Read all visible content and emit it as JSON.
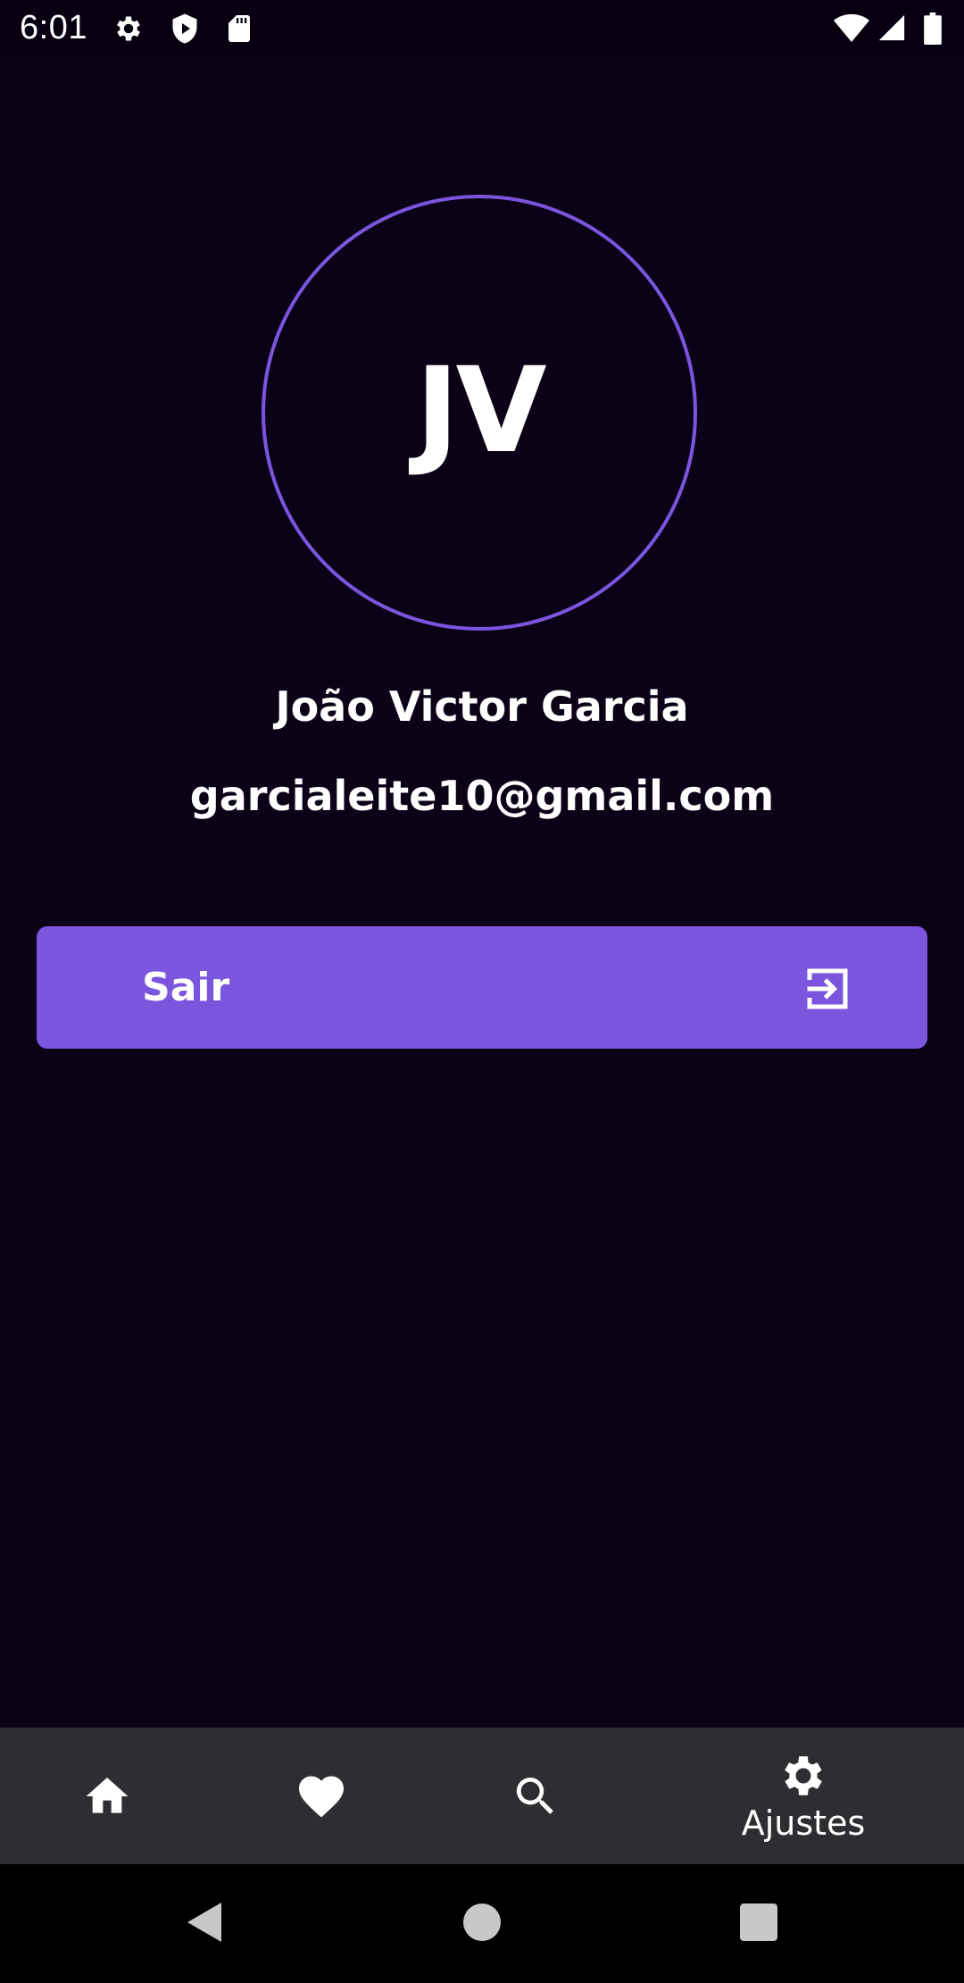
{
  "status_bar": {
    "time": "6:01",
    "left_icons": [
      "settings-icon",
      "shield-play-icon",
      "sd-card-icon"
    ],
    "right_icons": [
      "wifi-icon",
      "signal-icon",
      "battery-icon"
    ]
  },
  "profile": {
    "initials": "JV",
    "name": "João Victor Garcia",
    "email": "garcialeite10@gmail.com",
    "accent_color": "#7c55df"
  },
  "logout": {
    "label": "Sair",
    "icon": "logout-icon"
  },
  "bottom_nav": {
    "items": [
      {
        "icon": "home-icon",
        "label": ""
      },
      {
        "icon": "heart-icon",
        "label": ""
      },
      {
        "icon": "search-icon",
        "label": ""
      },
      {
        "icon": "gear-icon",
        "label": "Ajustes",
        "active": true
      }
    ]
  },
  "system_nav": {
    "buttons": [
      "back-icon",
      "home-circle-icon",
      "recents-icon"
    ]
  },
  "colors": {
    "background": "#0b0218",
    "accent": "#7c55df",
    "nav_background": "#2f2d31"
  }
}
